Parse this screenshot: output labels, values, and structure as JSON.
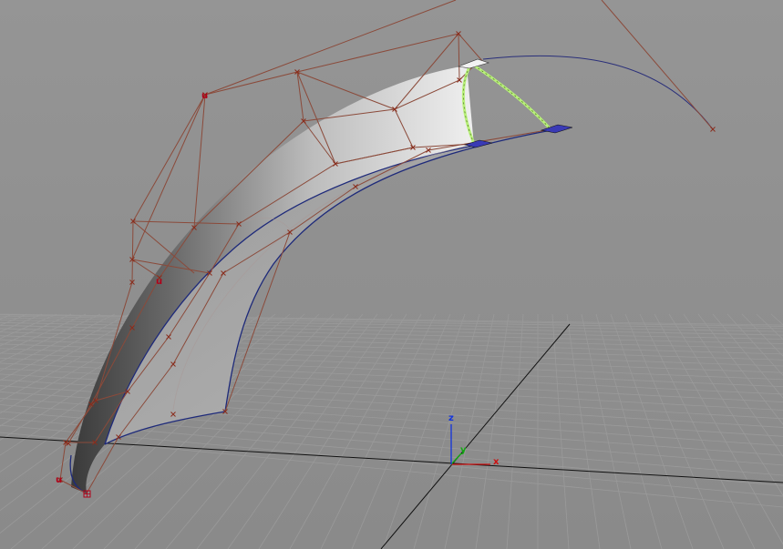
{
  "viewport": {
    "name": "perspective-viewport",
    "background_top": "#929292",
    "background_bottom": "#8a8a8a"
  },
  "colors": {
    "grid_line": "#9a9a9a",
    "grid_major": "#1a1a1a",
    "hull": "#8b4a3a",
    "cv": "#8a2c1c",
    "curve": "#1e2a7a",
    "highlight": "#b8f07a",
    "axis_x": "#cc1111",
    "axis_y": "#11aa11",
    "axis_z": "#1133dd",
    "u_marker": "#b0001a"
  },
  "axis": {
    "x_label": "x",
    "y_label": "y",
    "z_label": "z"
  },
  "markers": {
    "u_label": "u"
  },
  "icons": {
    "manipulator_handle": "arrow-handle-icon",
    "origin_cv": "square-cv-icon"
  }
}
